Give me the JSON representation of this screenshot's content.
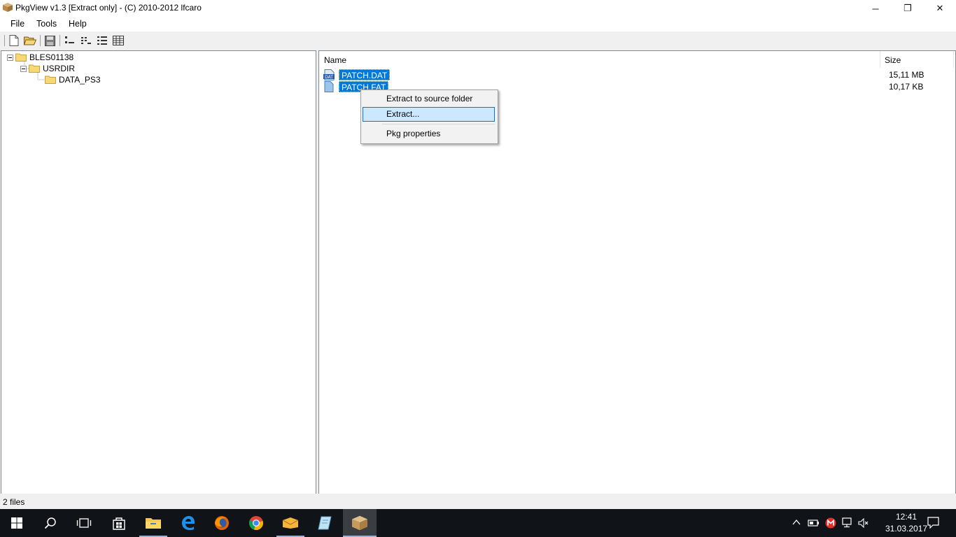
{
  "window": {
    "title": "PkgView v1.3 [Extract only] - (C) 2010-2012 lfcaro",
    "minimize": "─",
    "restore": "❐",
    "close": "✕"
  },
  "menu": [
    "File",
    "Tools",
    "Help"
  ],
  "tree": {
    "root": "BLES01138",
    "child": "USRDIR",
    "grandchild": "DATA_PS3"
  },
  "list": {
    "columns": {
      "name": "Name",
      "size": "Size"
    },
    "files": [
      {
        "name": "PATCH.DAT",
        "size": "15,11 MB",
        "icon": "dat-file-icon"
      },
      {
        "name": "PATCH.FAT",
        "size": "10,17 KB",
        "icon": "file-icon"
      }
    ]
  },
  "context_menu": {
    "extract_to_source": "Extract to source folder",
    "extract": "Extract...",
    "pkg_properties": "Pkg properties"
  },
  "status": {
    "text": "2 files"
  },
  "taskbar": {
    "time": "12:41",
    "date": "31.03.2017"
  },
  "colors": {
    "selection": "#0078d7",
    "menu_highlight": "#cce8ff",
    "taskbar": "#101418"
  }
}
